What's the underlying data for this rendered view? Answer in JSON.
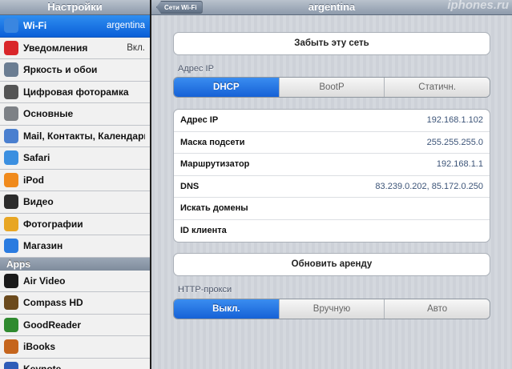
{
  "sidebar": {
    "title": "Настройки",
    "items": [
      {
        "label": "Wi-Fi",
        "value": "argentina",
        "icon": "wifi-icon",
        "color": "#3a86e0",
        "selected": true
      },
      {
        "label": "Уведомления",
        "value": "Вкл.",
        "icon": "notifications-icon",
        "color": "#d9262a",
        "selected": false
      },
      {
        "label": "Яркость и обои",
        "value": "",
        "icon": "brightness-icon",
        "color": "#6b7d92",
        "selected": false
      },
      {
        "label": "Цифровая фоторамка",
        "value": "",
        "icon": "photo-frame-icon",
        "color": "#555",
        "selected": false
      },
      {
        "label": "Основные",
        "value": "",
        "icon": "gear-icon",
        "color": "#7d8186",
        "selected": false
      },
      {
        "label": "Mail, Контакты, Календари",
        "value": "",
        "icon": "mail-icon",
        "color": "#4a7fcf",
        "selected": false
      },
      {
        "label": "Safari",
        "value": "",
        "icon": "safari-icon",
        "color": "#3b8fe0",
        "selected": false
      },
      {
        "label": "iPod",
        "value": "",
        "icon": "ipod-icon",
        "color": "#f08a1c",
        "selected": false
      },
      {
        "label": "Видео",
        "value": "",
        "icon": "video-icon",
        "color": "#2c2c2c",
        "selected": false
      },
      {
        "label": "Фотографии",
        "value": "",
        "icon": "photos-icon",
        "color": "#e8a624",
        "selected": false
      },
      {
        "label": "Магазин",
        "value": "",
        "icon": "store-icon",
        "color": "#2a7be0",
        "selected": false
      }
    ],
    "apps_section": "Apps",
    "apps": [
      {
        "label": "Air Video",
        "icon": "air-video-icon",
        "color": "#1a1a1a"
      },
      {
        "label": "Compass HD",
        "icon": "compass-icon",
        "color": "#6b4a1d"
      },
      {
        "label": "GoodReader",
        "icon": "goodreader-icon",
        "color": "#2f8a2f"
      },
      {
        "label": "iBooks",
        "icon": "ibooks-icon",
        "color": "#c5651d"
      },
      {
        "label": "Keynote",
        "icon": "keynote-icon",
        "color": "#2f5db8"
      }
    ]
  },
  "nav": {
    "back_label": "Сети Wi-Fi",
    "title": "argentina",
    "watermark": "iphones.ru"
  },
  "forget_button": "Забыть эту сеть",
  "ip_section": {
    "label": "Адрес IP",
    "modes": [
      {
        "label": "DHCP",
        "active": true
      },
      {
        "label": "BootP",
        "active": false
      },
      {
        "label": "Статичн.",
        "active": false
      }
    ],
    "rows": [
      {
        "label": "Адрес IP",
        "value": "192.168.1.102"
      },
      {
        "label": "Маска подсети",
        "value": "255.255.255.0"
      },
      {
        "label": "Маршрутизатор",
        "value": "192.168.1.1"
      },
      {
        "label": "DNS",
        "value": "83.239.0.202, 85.172.0.250"
      },
      {
        "label": "Искать домены",
        "value": ""
      },
      {
        "label": "ID клиента",
        "value": ""
      }
    ]
  },
  "renew_button": "Обновить аренду",
  "proxy_section": {
    "label": "HTTP-прокси",
    "modes": [
      {
        "label": "Выкл.",
        "active": true
      },
      {
        "label": "Вручную",
        "active": false
      },
      {
        "label": "Авто",
        "active": false
      }
    ]
  },
  "colors": {
    "accent": "#1a6fe0",
    "sidebar_bg": "#d7d9de",
    "nav_bar": "#8d9aab"
  }
}
